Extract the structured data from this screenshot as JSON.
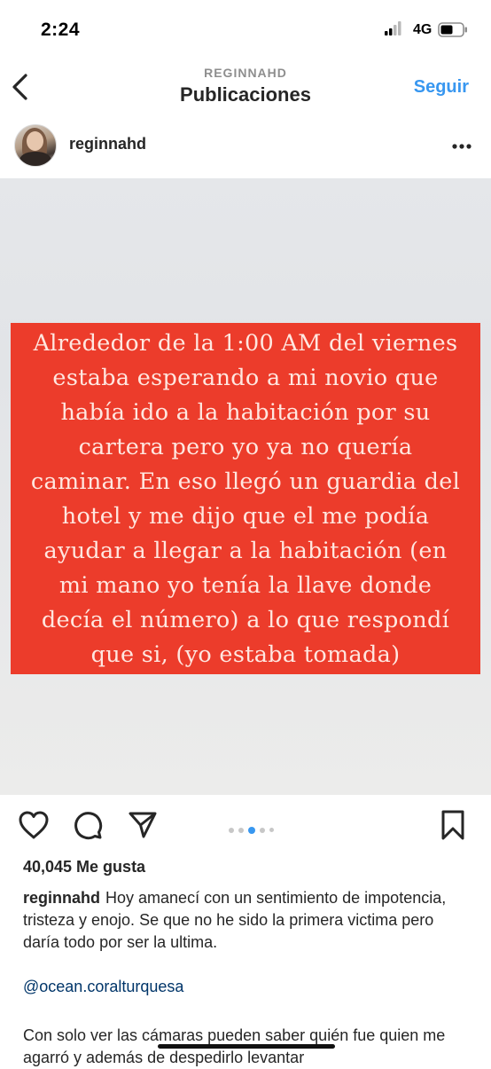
{
  "status_bar": {
    "time": "2:24",
    "network": "4G"
  },
  "nav": {
    "username": "REGINNAHD",
    "title": "Publicaciones",
    "follow_label": "Seguir"
  },
  "post": {
    "username": "reginnahd",
    "image_text": "Alrededor de la 1:00 AM del viernes estaba esperando a mi novio que había ido a la habitación por su cartera pero yo ya no quería caminar. En eso llegó un guardia del hotel y me dijo que el me podía ayudar a llegar a la habitación (en mi mano yo tenía la llave donde decía el número) a lo que respondí que si, (yo estaba tomada)",
    "image_background": "#e5e7ea",
    "box_color": "#ec3c2b",
    "carousel": {
      "count": 5,
      "active_index": 2
    },
    "likes": "40,045 Me gusta",
    "caption_user": "reginnahd",
    "caption_text": "Hoy amanecí con un sentimiento de impotencia, tristeza y enojo.  Se que no he sido la primera victima pero daría todo por ser la ultima.",
    "mention": "@ocean.coralturquesa",
    "more_text": "Con solo ver las cámaras pueden saber quién fue quien me agarró y además de despedirlo levantar"
  },
  "icons": [
    "back-chevron-icon",
    "more-dots-icon",
    "heart-icon",
    "comment-icon",
    "share-icon",
    "bookmark-icon"
  ],
  "colors": {
    "accent": "#3897f0",
    "mention": "#003569",
    "text": "#262626",
    "muted": "#8e8e8e"
  }
}
